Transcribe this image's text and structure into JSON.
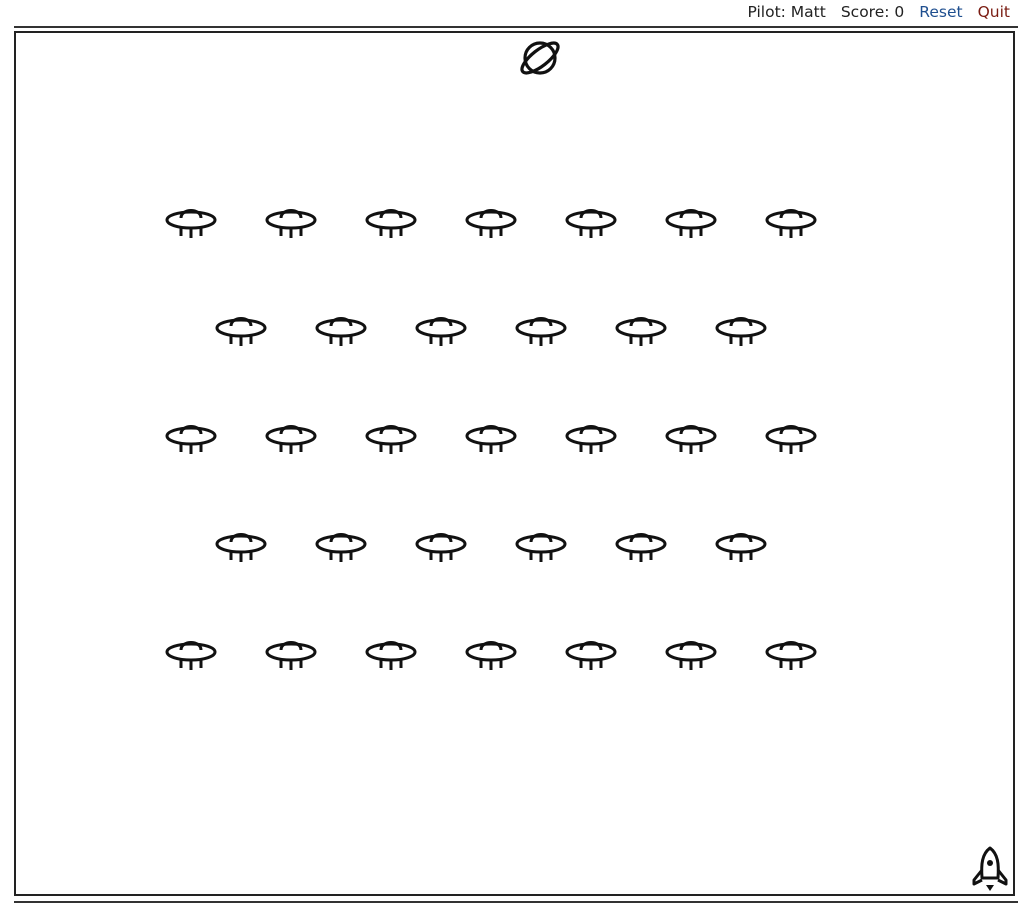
{
  "hud": {
    "pilot_label": "Pilot: Matt",
    "score_label": "Score: 0",
    "reset_label": "Reset",
    "quit_label": "Quit"
  },
  "sprites": {
    "target_icon": "planet-icon",
    "player_icon": "rocket-icon",
    "enemy_icon": "ufo-icon"
  },
  "enemy_rows": [
    7,
    6,
    7,
    6,
    7
  ],
  "colors": {
    "stroke": "#111111",
    "reset": "#1f4f8f",
    "quit": "#7a1c12"
  }
}
